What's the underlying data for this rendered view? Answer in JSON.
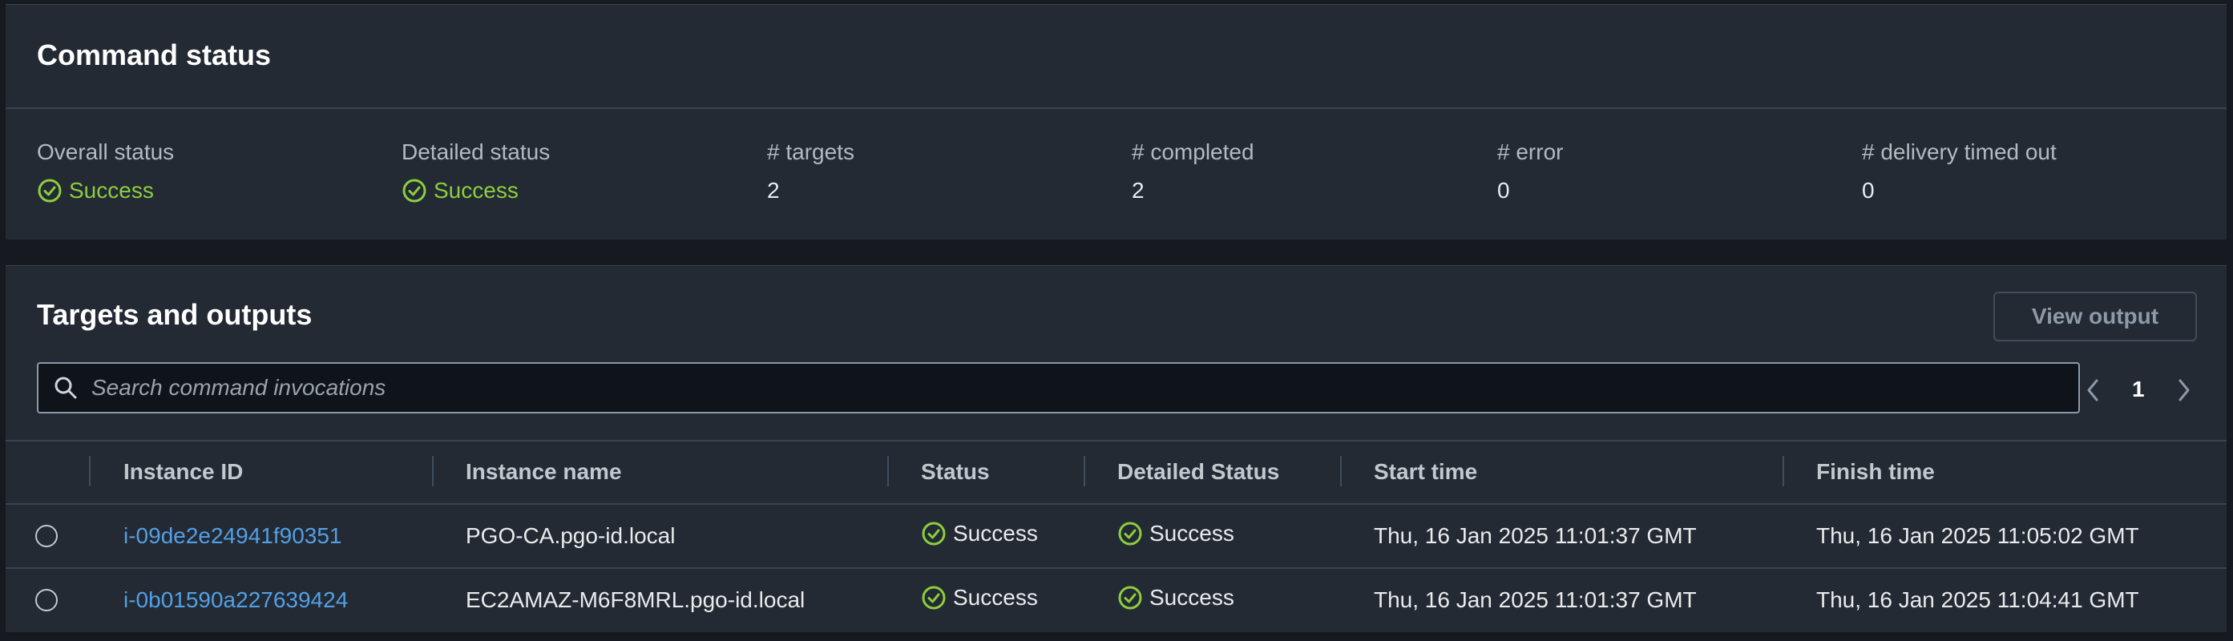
{
  "command_status": {
    "title": "Command status",
    "stats": [
      {
        "label": "Overall status",
        "value": "Success"
      },
      {
        "label": "Detailed status",
        "value": "Success"
      },
      {
        "label": "# targets",
        "value": "2"
      },
      {
        "label": "# completed",
        "value": "2"
      },
      {
        "label": "# error",
        "value": "0"
      },
      {
        "label": "# delivery timed out",
        "value": "0"
      }
    ]
  },
  "targets": {
    "title": "Targets and outputs",
    "view_output_label": "View output",
    "search_placeholder": "Search command invocations",
    "page": "1",
    "columns": [
      "Instance ID",
      "Instance name",
      "Status",
      "Detailed Status",
      "Start time",
      "Finish time"
    ],
    "rows": [
      {
        "instance_id": "i-09de2e24941f90351",
        "instance_name": "PGO-CA.pgo-id.local",
        "status": "Success",
        "detailed_status": "Success",
        "start_time": "Thu, 16 Jan 2025 11:01:37 GMT",
        "finish_time": "Thu, 16 Jan 2025 11:05:02 GMT"
      },
      {
        "instance_id": "i-0b01590a227639424",
        "instance_name": "EC2AMAZ-M6F8MRL.pgo-id.local",
        "status": "Success",
        "detailed_status": "Success",
        "start_time": "Thu, 16 Jan 2025 11:01:37 GMT",
        "finish_time": "Thu, 16 Jan 2025 11:04:41 GMT"
      }
    ]
  },
  "colors": {
    "success": "#8ccd3f",
    "link": "#539fe5",
    "panel_bg": "#232a33",
    "page_bg": "#16191f"
  },
  "icons": {
    "success": "check-circle-icon",
    "search": "search-icon",
    "prev": "chevron-left-icon",
    "next": "chevron-right-icon"
  }
}
